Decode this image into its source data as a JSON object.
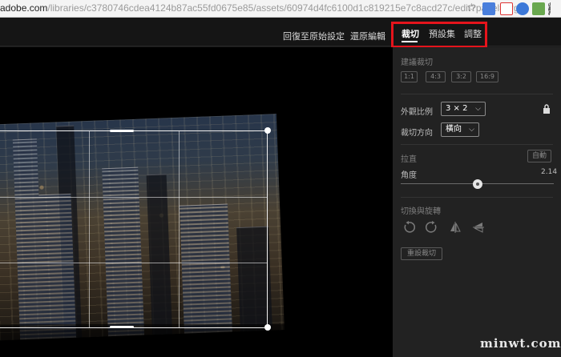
{
  "browser": {
    "url_host": "adobe.com",
    "url_path": "/libraries/c3780746cdea4124b87ac55fd0675e85/assets/60974d4fc6100d1c819215e7c8acd27c/edit?panel=org..."
  },
  "header": {
    "reset_label": "回復至原始設定",
    "revert_label": "還原編輯",
    "tabs": [
      {
        "label": "裁切",
        "active": true
      },
      {
        "label": "預設集",
        "active": false
      },
      {
        "label": "調整",
        "active": false
      }
    ]
  },
  "panel": {
    "suggest_title": "建議裁切",
    "ratios": [
      "1:1",
      "4:3",
      "3:2",
      "16:9"
    ],
    "aspect_label": "外觀比例",
    "aspect_value": "3 × 2",
    "orientation_label": "裁切方向",
    "orientation_value": "橫向",
    "straighten_title": "拉直",
    "auto_label": "自動",
    "angle_label": "角度",
    "angle_value": "2.14",
    "angle_slider_fraction": 0.5,
    "transform_title": "切換與旋轉",
    "tools": [
      "rotate-left-icon",
      "rotate-right-icon",
      "flip-horizontal-icon",
      "flip-vertical-icon"
    ],
    "reset_crop_label": "重設裁切"
  },
  "watermark": "minwt.com",
  "colors": {
    "highlight_box": "#e5141c",
    "panel_bg": "#222222",
    "canvas_bg": "#000000"
  }
}
